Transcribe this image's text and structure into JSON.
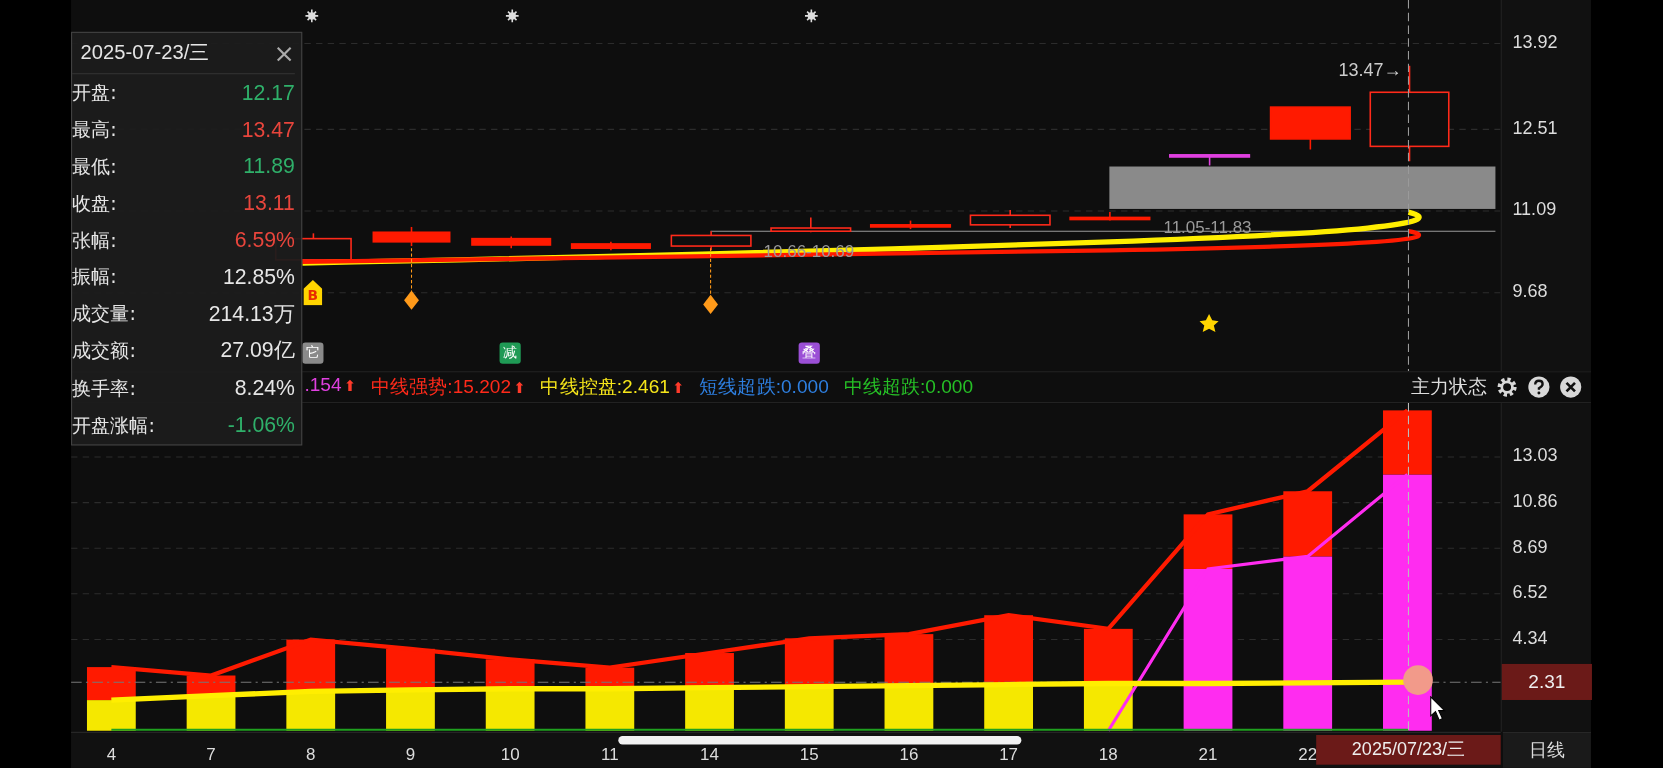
{
  "info_panel": {
    "date": "2025-07-23/三",
    "close": "×",
    "rows": [
      {
        "label": "开盘:",
        "value": "12.17",
        "color": "#2fb06a"
      },
      {
        "label": "最高:",
        "value": "13.47",
        "color": "#e8453c"
      },
      {
        "label": "最低:",
        "value": "11.89",
        "color": "#2fb06a"
      },
      {
        "label": "收盘:",
        "value": "13.11",
        "color": "#e8453c"
      },
      {
        "label": "张幅:",
        "value": "6.59%",
        "color": "#e8453c"
      },
      {
        "label": "振幅:",
        "value": "12.85%",
        "color": "#e6e6e6"
      },
      {
        "label": "成交量:",
        "value": "214.13万",
        "color": "#e6e6e6"
      },
      {
        "label": "成交额:",
        "value": "27.09亿",
        "color": "#e6e6e6"
      },
      {
        "label": "换手率:",
        "value": "8.24%",
        "color": "#e6e6e6"
      },
      {
        "label": "开盘涨幅:",
        "value": "-1.06%",
        "color": "#2fb06a"
      }
    ]
  },
  "price_chart": {
    "yticks": [
      "13.92",
      "12.51",
      "11.09",
      "9.68"
    ],
    "high_label": "13.47→",
    "ranges": [
      "10.66-10.69",
      "11.05-11.83"
    ],
    "signals": [
      {
        "kind": "buy",
        "text": "B"
      },
      {
        "kind": "badge",
        "text": "它",
        "color": "#8a8a8a"
      },
      {
        "kind": "badge",
        "text": "减",
        "color": "#1f9a55"
      },
      {
        "kind": "badge",
        "text": "叠",
        "color": "#9b4fd6"
      }
    ]
  },
  "indicator": {
    "legend": [
      {
        "text": ".154",
        "color": "#e040e0",
        "arrow": "⬆"
      },
      {
        "text": "中线强势:15.202",
        "color": "#ff2a1a",
        "arrow": "⬆"
      },
      {
        "text": "中线控盘:2.461",
        "color": "#f5e51a",
        "arrow": "⬆"
      },
      {
        "text": "短线超跌:0.000",
        "color": "#2e7fe0"
      },
      {
        "text": "中线超跌:0.000",
        "color": "#26c026"
      }
    ],
    "title": "主力状态",
    "current_value": "2.31",
    "chart_data": {
      "type": "bar",
      "stacked": true,
      "categories": [
        "4",
        "7",
        "8",
        "9",
        "10",
        "11",
        "14",
        "15",
        "16",
        "17",
        "18",
        "21",
        "22",
        "2025/07/23/三"
      ],
      "series": [
        {
          "color": "#f5e800",
          "values": [
            1.46,
            1.67,
            1.87,
            1.95,
            2.0,
            2.0,
            2.05,
            2.1,
            2.15,
            2.2,
            2.25,
            null,
            null,
            null
          ]
        },
        {
          "color": "#ff2cf0",
          "values": [
            null,
            null,
            null,
            null,
            null,
            null,
            null,
            null,
            null,
            null,
            null,
            7.7,
            8.3,
            12.2
          ]
        },
        {
          "color": "#ff1a00",
          "values": [
            1.57,
            0.96,
            2.47,
            1.95,
            1.4,
            1.0,
            1.65,
            2.3,
            2.45,
            3.3,
            2.6,
            2.6,
            3.1,
            3.05
          ]
        }
      ],
      "ylim": [
        0,
        15.6
      ],
      "grid": true,
      "yticks": [
        4.34,
        6.52,
        8.69,
        10.86,
        13.03
      ]
    }
  },
  "period": "日线"
}
